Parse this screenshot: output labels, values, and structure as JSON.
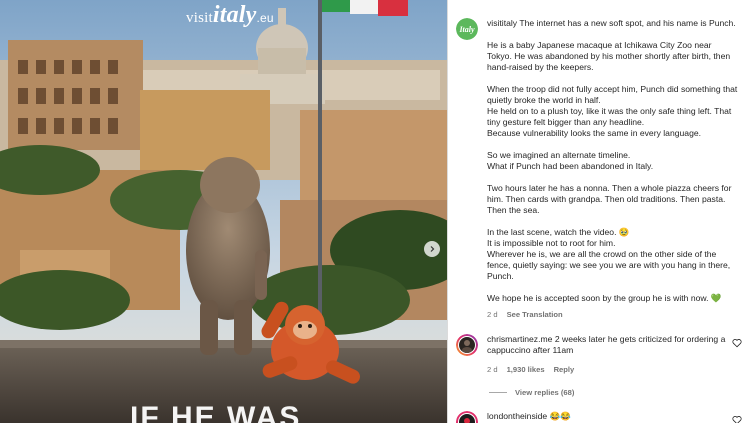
{
  "post": {
    "brand_prefix": "visit",
    "brand_word": "italy",
    "brand_suffix": ".eu",
    "overlay_text": "IF HE WAS",
    "next_button_icon": "chevron-right-icon"
  },
  "caption": {
    "username": "visititaly",
    "paragraphs": [
      "The internet has a new soft spot, and his name is Punch.",
      "He is a baby Japanese macaque at Ichikawa City Zoo near Tokyo. He was abandoned by his mother shortly after birth, then hand-raised by the keepers.",
      "When the troop did not fully accept him, Punch did something that quietly broke the world in half.",
      " He held on to a plush toy, like it was the only safe thing left. That tiny gesture felt bigger than any headline.",
      " Because vulnerability looks the same in every language.",
      "So we imagined an alternate timeline.",
      "What if Punch had been abandoned in Italy.",
      "Two hours later he has a nonna. Then a whole piazza cheers for him. Then cards with grandpa. Then old traditions. Then pasta. Then the sea.",
      "In the last scene, watch the video. 🥹",
      "It is impossible not to root for him.",
      "Wherever he is, we are all the crowd on the other side of the fence, quietly saying: we see you we are with you hang in there, Punch.",
      "We hope he is accepted soon by the group he is with now. 💚"
    ],
    "time": "2 d",
    "see_translation": "See Translation"
  },
  "comments": [
    {
      "username": "chrismartinez.me",
      "text": "2 weeks later he gets criticized for ordering a cappuccino after 11am",
      "time": "2 d",
      "likes": "1,930 likes",
      "reply": "Reply",
      "view_replies": "View replies (68)"
    },
    {
      "username": "londontheinside",
      "text": "😂😂"
    }
  ],
  "colors": {
    "brand_green": "#5cb85c",
    "heart_love": "#e04b5a",
    "secondary_text": "#737373"
  }
}
